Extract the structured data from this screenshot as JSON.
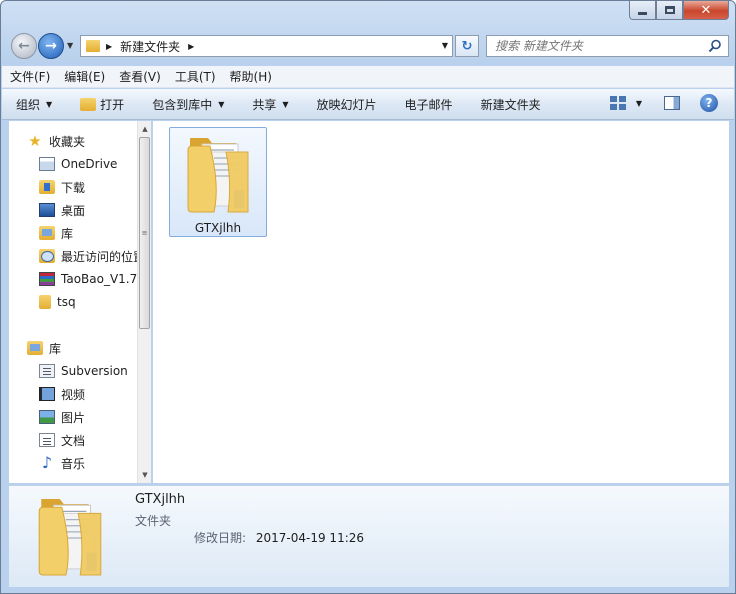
{
  "window": {
    "controls": {
      "minimize": "minimize",
      "maximize": "maximize",
      "close": "✕"
    }
  },
  "address": {
    "path": "新建文件夹"
  },
  "search": {
    "placeholder": "搜索 新建文件夹"
  },
  "menubar": [
    "文件(F)",
    "编辑(E)",
    "查看(V)",
    "工具(T)",
    "帮助(H)"
  ],
  "toolbar": {
    "organize": "组织",
    "open": "打开",
    "include_in_library": "包含到库中",
    "share": "共享",
    "slideshow": "放映幻灯片",
    "email": "电子邮件",
    "new_folder": "新建文件夹",
    "help": "?"
  },
  "nav": {
    "favorites": "收藏夹",
    "fav_items": [
      "OneDrive",
      "下载",
      "桌面",
      "库",
      "最近访问的位置",
      "TaoBao_V1.7",
      "tsq"
    ],
    "libraries": "库",
    "lib_items": [
      "Subversion",
      "视频",
      "图片",
      "文档",
      "音乐"
    ]
  },
  "content": {
    "items": [
      {
        "name": "GTXjlhh"
      }
    ]
  },
  "details": {
    "name": "GTXjlhh",
    "type": "文件夹",
    "modified_label": "修改日期:",
    "modified_value": "2017-04-19 11:26"
  },
  "colors": {
    "accent": "#2d6fc2",
    "folder": "#e3ae33",
    "selection": "#d8e7f9"
  }
}
